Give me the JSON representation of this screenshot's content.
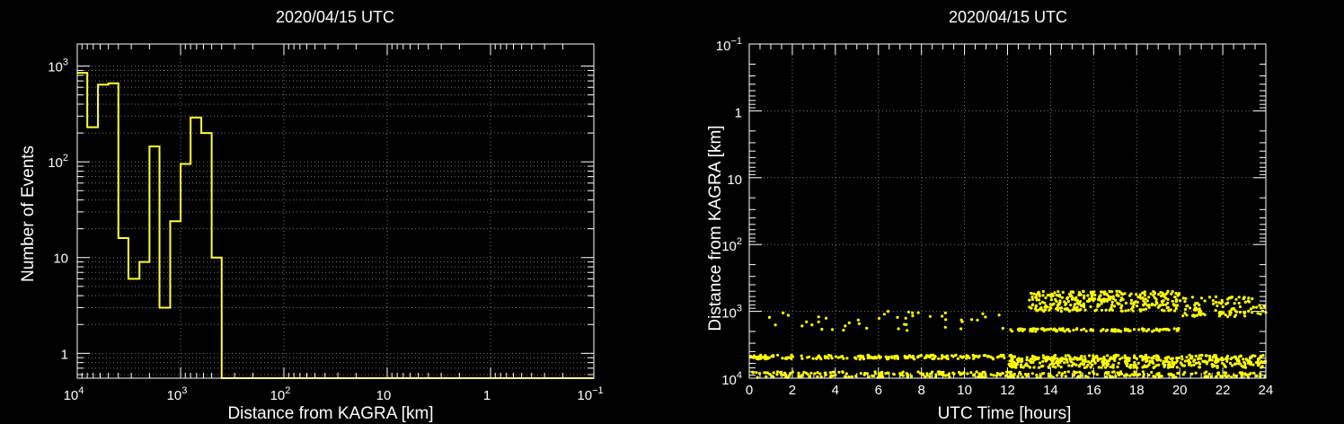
{
  "chart_data": [
    {
      "type": "histogram",
      "title": "2020/04/15 UTC",
      "xlabel": "Distance from KAGRA [km]",
      "ylabel": "Number of Events",
      "xscale": "log",
      "xaxis_reversed": true,
      "yscale": "log",
      "xlim": [
        10000,
        0.1
      ],
      "ylim": [
        0.55,
        1700
      ],
      "x_tick_labels": [
        {
          "base": "10",
          "exp": "4"
        },
        {
          "base": "10",
          "exp": "3"
        },
        {
          "base": "10",
          "exp": "2"
        },
        {
          "base": "10",
          "exp": ""
        },
        {
          "base": "1",
          "exp": ""
        },
        {
          "base": "10",
          "exp": "−1"
        }
      ],
      "y_tick_labels": [
        {
          "base": "1",
          "exp": ""
        },
        {
          "base": "10",
          "exp": ""
        },
        {
          "base": "10",
          "exp": "2"
        },
        {
          "base": "10",
          "exp": "3"
        }
      ],
      "grid": true,
      "line_color": "#ffff33",
      "bins": [
        {
          "lo": 10000,
          "hi": 8000,
          "count": 850
        },
        {
          "lo": 8000,
          "hi": 6300,
          "count": 230
        },
        {
          "lo": 6300,
          "hi": 5000,
          "count": 640
        },
        {
          "lo": 5000,
          "hi": 4000,
          "count": 660
        },
        {
          "lo": 4000,
          "hi": 3200,
          "count": 16
        },
        {
          "lo": 3200,
          "hi": 2500,
          "count": 6
        },
        {
          "lo": 2500,
          "hi": 2000,
          "count": 9
        },
        {
          "lo": 2000,
          "hi": 1600,
          "count": 145
        },
        {
          "lo": 1600,
          "hi": 1260,
          "count": 3
        },
        {
          "lo": 1260,
          "hi": 1000,
          "count": 24
        },
        {
          "lo": 1000,
          "hi": 800,
          "count": 95
        },
        {
          "lo": 800,
          "hi": 630,
          "count": 290
        },
        {
          "lo": 630,
          "hi": 500,
          "count": 200
        },
        {
          "lo": 500,
          "hi": 400,
          "count": 10
        },
        {
          "lo": 400,
          "hi": 0.1,
          "count": 0
        }
      ]
    },
    {
      "type": "scatter",
      "title": "2020/04/15 UTC",
      "xlabel": "UTC Time [hours]",
      "ylabel": "Distance from KAGRA [km]",
      "xlim": [
        0,
        24
      ],
      "x_ticks": [
        0,
        2,
        4,
        6,
        8,
        10,
        12,
        14,
        16,
        18,
        20,
        22,
        24
      ],
      "yscale": "log",
      "yaxis_reversed": true,
      "ylim": [
        0.1,
        10000
      ],
      "y_tick_labels": [
        {
          "base": "10",
          "exp": "−1"
        },
        {
          "base": "1",
          "exp": ""
        },
        {
          "base": "10",
          "exp": ""
        },
        {
          "base": "10",
          "exp": "2"
        },
        {
          "base": "10",
          "exp": "3"
        },
        {
          "base": "10",
          "exp": "4"
        }
      ],
      "grid": true,
      "point_color": "#ffff00",
      "clusters": [
        {
          "x_range": [
            0,
            24
          ],
          "distance_range": [
            4500,
            5200
          ],
          "density": "dense"
        },
        {
          "x_range": [
            0,
            24
          ],
          "distance_range": [
            8000,
            9800
          ],
          "density": "dense"
        },
        {
          "x_range": [
            12,
            24
          ],
          "distance_range": [
            5000,
            7000
          ],
          "density": "dense"
        },
        {
          "x_range": [
            13,
            20
          ],
          "distance_range": [
            500,
            1000
          ],
          "density": "dense"
        },
        {
          "x_range": [
            0.5,
            12
          ],
          "distance_range": [
            1000,
            2000
          ],
          "density": "sparse"
        },
        {
          "x_range": [
            12,
            20
          ],
          "distance_range": [
            1800,
            2000
          ],
          "density": "medium"
        },
        {
          "x_range": [
            20,
            24
          ],
          "distance_range": [
            600,
            1200
          ],
          "density": "medium"
        }
      ]
    }
  ]
}
